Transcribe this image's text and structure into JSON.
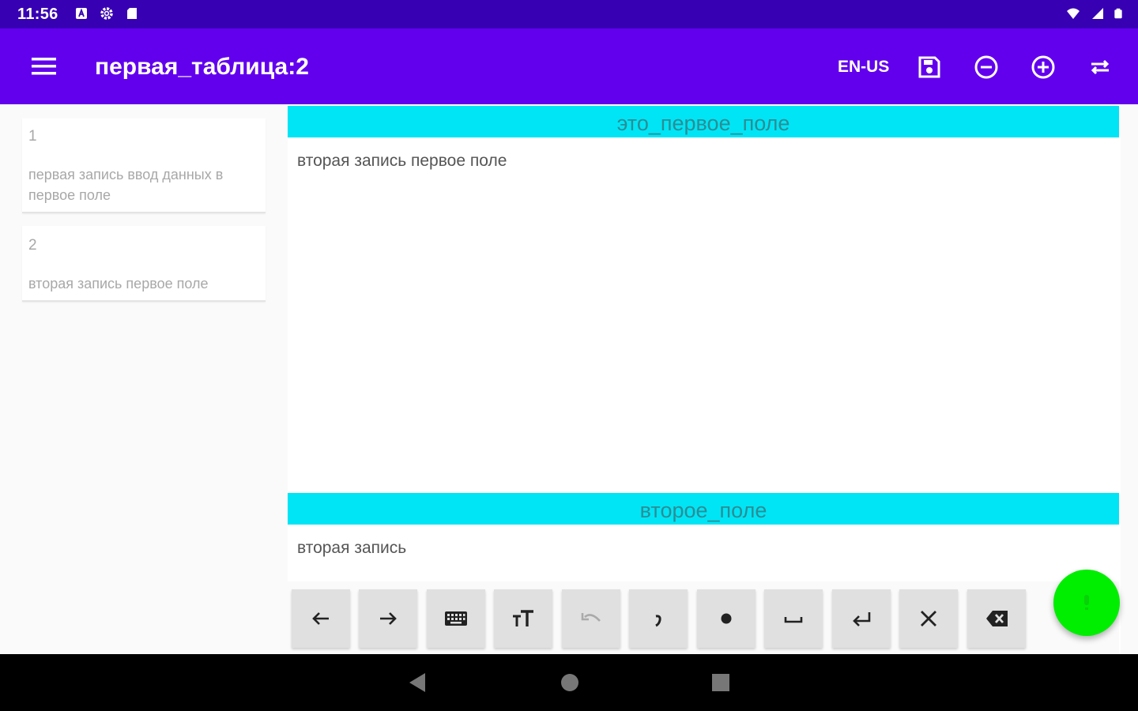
{
  "status_bar": {
    "time": "11:56",
    "left_icons": [
      "notification-a-icon",
      "gear-icon",
      "sd-card-icon"
    ],
    "right_icons": [
      "wifi-icon",
      "signal-icon",
      "battery-icon"
    ]
  },
  "app_bar": {
    "title": "первая_таблица:2",
    "locale": "EN-US",
    "actions": [
      "save-icon",
      "remove-circle-icon",
      "add-circle-icon",
      "swap-icon"
    ],
    "color": "#6200ee"
  },
  "records": [
    {
      "number": "1",
      "text": "первая запись ввод данных в первое поле"
    },
    {
      "number": "2",
      "text": "вторая запись первое поле"
    }
  ],
  "fields": [
    {
      "header": "это_первое_поле",
      "value": "вторая запись первое поле"
    },
    {
      "header": "второе_поле",
      "value": "вторая запись"
    }
  ],
  "keyboard_keys": [
    "arrow-left-icon",
    "arrow-right-icon",
    "keyboard-icon",
    "text-size-icon",
    "undo-icon",
    "comma-icon",
    "dot-icon",
    "space-icon",
    "enter-icon",
    "close-icon",
    "backspace-icon"
  ],
  "fab": {
    "icon": "microphone-icon",
    "color": "#00ee00"
  },
  "colors": {
    "status_bar": "#3700b3",
    "field_header": "#00e5f5"
  }
}
